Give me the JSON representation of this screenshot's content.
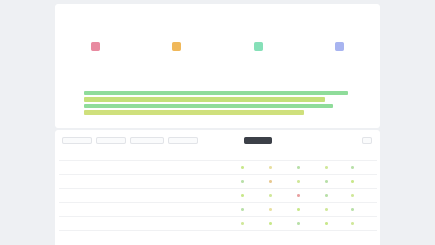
{
  "header": {
    "title": "",
    "subtitle": ""
  },
  "summary": {
    "label": "",
    "items": [
      {
        "icon": "alert-icon",
        "color": "#e88aa0",
        "value": "",
        "label": ""
      },
      {
        "icon": "warning-icon",
        "color": "#f0b85a",
        "value": "",
        "label": ""
      },
      {
        "icon": "check-icon",
        "color": "#86e0b8",
        "value": "",
        "label": ""
      },
      {
        "icon": "info-icon",
        "color": "#a8b4f0",
        "value": "",
        "label": ""
      }
    ]
  },
  "coverage": {
    "label": "",
    "rows": [
      {
        "label": "",
        "fraction": 0.91,
        "color": "#8fdc9a"
      },
      {
        "label": "",
        "fraction": 0.83,
        "color": "#c4e07a"
      },
      {
        "label": "",
        "fraction": 0.86,
        "color": "#8fdc9a"
      },
      {
        "label": "",
        "fraction": 0.76,
        "color": "#cfe07c"
      }
    ]
  },
  "toolbar": {
    "buttons": [
      "",
      "",
      "",
      ""
    ],
    "primary_label": "",
    "secondary_label": ""
  },
  "table": {
    "columns": [
      "",
      "",
      "",
      "",
      "",
      "",
      "",
      "",
      "",
      ""
    ],
    "rows": [
      {
        "cells": [
          "",
          "",
          ""
        ],
        "dots": [
          "#c8e88a",
          "#e8e0a0",
          "#b8e0a8",
          "#d0e89a",
          "#b8e0a8"
        ]
      },
      {
        "cells": [
          "",
          "",
          ""
        ],
        "dots": [
          "#b8e0a8",
          "#e8c890",
          "#d0e89a",
          "#b8e0a8",
          "#c8e88a"
        ]
      },
      {
        "cells": [
          "",
          "",
          ""
        ],
        "dots": [
          "#c8e88a",
          "#d0e89a",
          "#e8a0a0",
          "#b8e0a8",
          "#d0e89a"
        ]
      },
      {
        "cells": [
          "",
          "",
          ""
        ],
        "dots": [
          "#b8e0a8",
          "#e8e0a0",
          "#c8e88a",
          "#d0e89a",
          "#b8e0a8"
        ]
      },
      {
        "cells": [
          "",
          "",
          ""
        ],
        "dots": [
          "#d0e89a",
          "#c8e88a",
          "#b8e0a8",
          "#c8e88a",
          "#d0e89a"
        ]
      }
    ]
  }
}
